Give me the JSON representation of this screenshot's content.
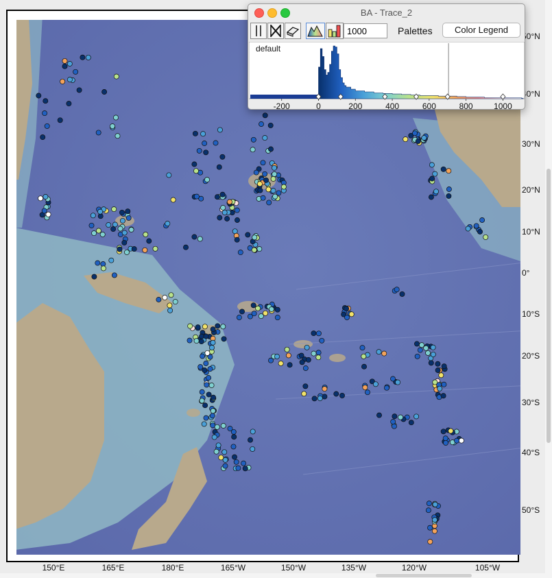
{
  "map": {
    "lon_ticks": [
      "150°E",
      "165°E",
      "180°E",
      "165°W",
      "150°W",
      "135°W",
      "120°W",
      "105°W"
    ],
    "lat_ticks": [
      "50°N",
      "40°N",
      "30°N",
      "20°N",
      "10°N",
      "0°",
      "10°S",
      "20°S",
      "30°S",
      "40°S",
      "50°S"
    ],
    "colors": {
      "ocean": "#6a7bb8",
      "deep_ocean": "#5a68aa",
      "land": "#b8a98c",
      "shelf": "#8fb7c4",
      "point_outline": "#111111"
    }
  },
  "histogram_window": {
    "title": "BA - Trace_2",
    "count_value": "1000",
    "palettes_label": "Palettes",
    "color_legend_label": "Color Legend",
    "palette_name": "default",
    "x_ticks": [
      "-200",
      "0",
      "200",
      "400",
      "600",
      "800",
      "1000"
    ],
    "icons": [
      "vertical-bars-icon",
      "crossed-box-icon",
      "eraser-icon",
      "histogram-palette-icon",
      "bar-chart-icon"
    ]
  },
  "chart_data": {
    "type": "bar",
    "title": "",
    "xlabel": "",
    "ylabel": "",
    "xlim": [
      -370,
      1110
    ],
    "x": [
      0,
      10,
      20,
      30,
      40,
      50,
      60,
      70,
      80,
      90,
      100,
      110,
      120,
      130,
      140,
      150,
      175,
      200,
      250,
      300,
      350,
      400,
      450,
      500,
      550,
      600,
      650,
      700,
      750,
      800,
      900,
      1000,
      1100
    ],
    "values": [
      60,
      95,
      80,
      55,
      45,
      50,
      65,
      90,
      100,
      98,
      85,
      55,
      40,
      30,
      25,
      22,
      18,
      15,
      13,
      11,
      10,
      9,
      8,
      7,
      6,
      6,
      5,
      5,
      4,
      3,
      2,
      2,
      1
    ],
    "markers": [
      0,
      120,
      360,
      530,
      700,
      1000
    ],
    "palette": [
      "#08306b",
      "#2060c0",
      "#4aa0d8",
      "#7fd0d0",
      "#b8e38c",
      "#f3e36a",
      "#f4a35a",
      "#f08c8c",
      "#fde0e0",
      "#ffffff"
    ]
  }
}
